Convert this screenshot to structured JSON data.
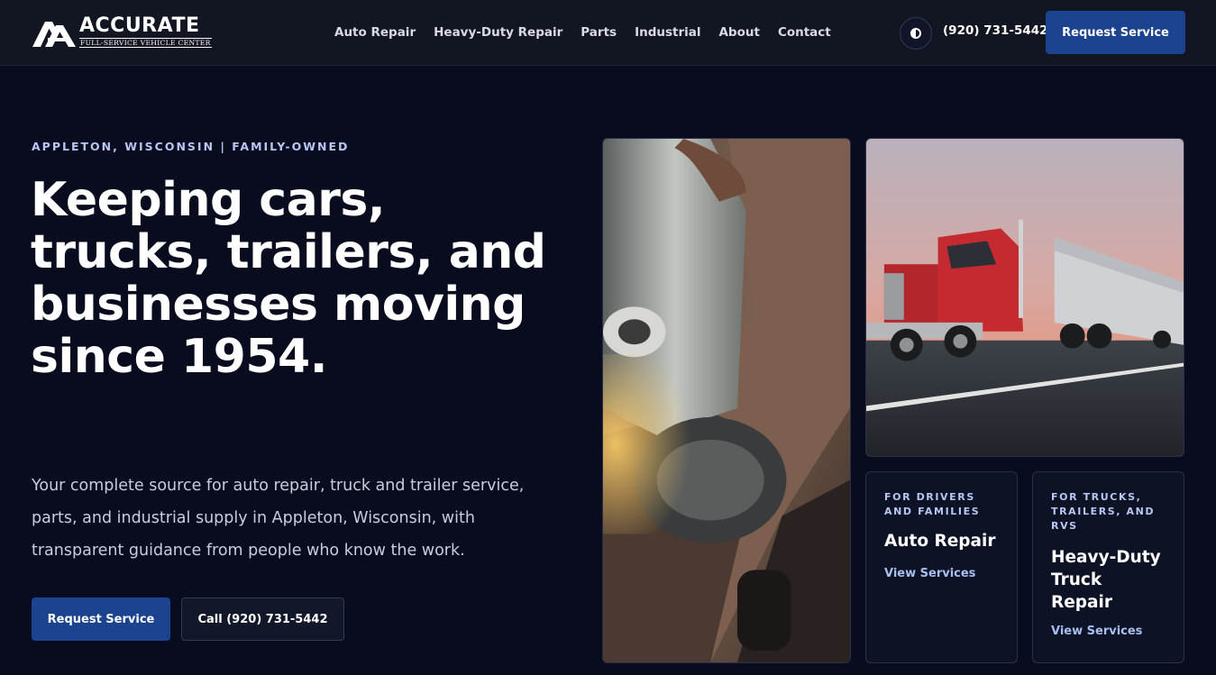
{
  "brand": {
    "name": "ACCURATE",
    "tagline": "FULL-SERVICE VEHICLE CENTER",
    "logo_icon": "aa-monogram-icon"
  },
  "nav": {
    "items": [
      {
        "label": "Auto Repair"
      },
      {
        "label": "Heavy-Duty Repair"
      },
      {
        "label": "Parts"
      },
      {
        "label": "Industrial"
      },
      {
        "label": "About"
      },
      {
        "label": "Contact"
      }
    ]
  },
  "header": {
    "theme_toggle_icon": "contrast-icon",
    "phone": "(920) 731-5442",
    "cta_label": "Request Service"
  },
  "hero": {
    "eyebrow": "APPLETON, WISCONSIN | FAMILY-OWNED",
    "headline": "Keeping cars, trucks, trailers, and businesses moving since 1954.",
    "lede": "Your complete source for auto repair, truck and trailer service, parts, and industrial supply in Appleton, Wisconsin, with transparent guidance from people who know the work.",
    "primary_cta": "Request Service",
    "secondary_cta": "Call (920) 731-5442"
  },
  "cards": [
    {
      "eyebrow": "FOR DRIVERS AND FAMILIES",
      "title": "Auto Repair",
      "link": "View Services"
    },
    {
      "eyebrow": "FOR TRUCKS, TRAILERS, AND RVS",
      "title": "Heavy-Duty Truck Repair",
      "link": "View Services"
    }
  ],
  "colors": {
    "background": "#090b1f",
    "header": "#121522",
    "accent": "#1b4390",
    "eyebrow": "#b5c7f2"
  }
}
